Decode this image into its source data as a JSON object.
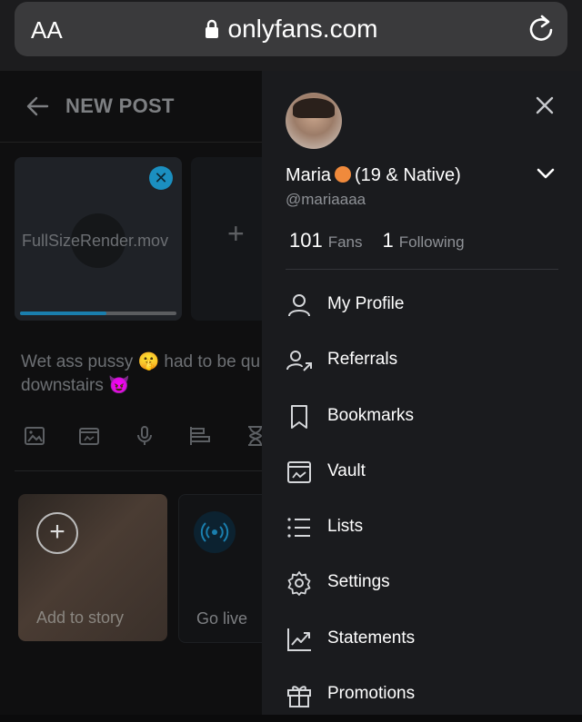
{
  "browser": {
    "aa_label": "AA",
    "url": "onlyfans.com"
  },
  "background_page": {
    "header_title": "NEW POST",
    "media": {
      "filename": "FullSizeRender.mov",
      "upload_progress": 0.55
    },
    "post_text": "Wet ass pussy 🤫 had to be qu… downstairs 😈",
    "post_text_line1": "Wet ass pussy 🤫 had to be qu",
    "post_text_line2": "downstairs 😈",
    "story_label": "Add to story",
    "live_label": "Go live"
  },
  "drawer": {
    "name": "Maria",
    "name_suffix": "(19 & Native)",
    "handle": "@mariaaaa",
    "fans_count": "101",
    "fans_label": "Fans",
    "following_count": "1",
    "following_label": "Following",
    "menu": [
      {
        "label": "My Profile",
        "icon": "user-icon"
      },
      {
        "label": "Referrals",
        "icon": "referrals-icon"
      },
      {
        "label": "Bookmarks",
        "icon": "bookmark-icon"
      },
      {
        "label": "Vault",
        "icon": "vault-icon"
      },
      {
        "label": "Lists",
        "icon": "lists-icon"
      },
      {
        "label": "Settings",
        "icon": "settings-gear-icon"
      },
      {
        "label": "Statements",
        "icon": "statements-chart-icon"
      },
      {
        "label": "Promotions",
        "icon": "gift-icon"
      }
    ]
  },
  "colors": {
    "accent": "#1a7fae",
    "drawer_bg": "#1a1b1e"
  }
}
